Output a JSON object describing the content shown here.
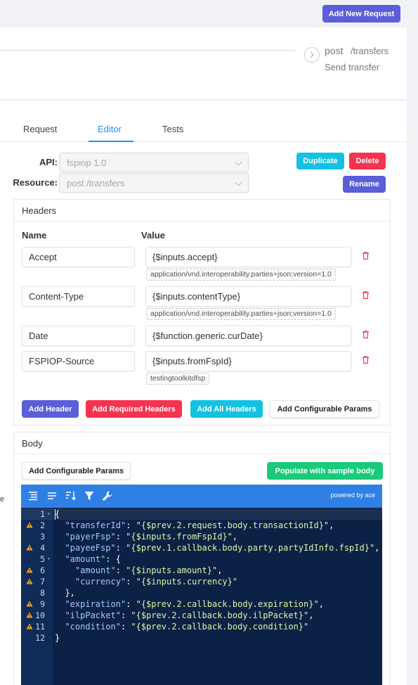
{
  "header": {
    "add_new_request": "Add New Request"
  },
  "step": {
    "method": "post",
    "path": "/transfers",
    "description": "Send transfer"
  },
  "tabs": [
    {
      "label": "Request"
    },
    {
      "label": "Editor"
    },
    {
      "label": "Tests"
    }
  ],
  "form": {
    "api_label": "API:",
    "api_value": "fspiop 1.0",
    "resource_label": "Resource:",
    "resource_value": "post /transfers",
    "duplicate": "Duplicate",
    "delete": "Delete",
    "rename": "Rename"
  },
  "headers": {
    "title": "Headers",
    "col_name": "Name",
    "col_value": "Value",
    "rows": [
      {
        "name": "Accept",
        "value": "{$inputs.accept}",
        "resolved": "application/vnd.interoperability.parties+json;version=1.0"
      },
      {
        "name": "Content-Type",
        "value": "{$inputs.contentType}",
        "resolved": "application/vnd.interoperability.parties+json;version=1.0"
      },
      {
        "name": "Date",
        "value": "{$function.generic.curDate}",
        "resolved": ""
      },
      {
        "name": "FSPIOP-Source",
        "value": "{$inputs.fromFspId}",
        "resolved": "testingtoolkitdfsp"
      }
    ],
    "buttons": {
      "add_header": "Add Header",
      "add_required": "Add Required Headers",
      "add_all": "Add All Headers",
      "add_configurable": "Add Configurable Params"
    }
  },
  "body": {
    "title": "Body",
    "add_configurable": "Add Configurable Params",
    "populate_sample": "Populate with sample body",
    "powered_by": "powered by ace",
    "edge_text": "e"
  },
  "colors": {
    "primary": "#5a5ed9",
    "cyan": "#13c2e3",
    "danger": "#f5334f",
    "success": "#1bc97c",
    "tab_active": "#1890ff",
    "editor_bg": "#0b2145"
  }
}
